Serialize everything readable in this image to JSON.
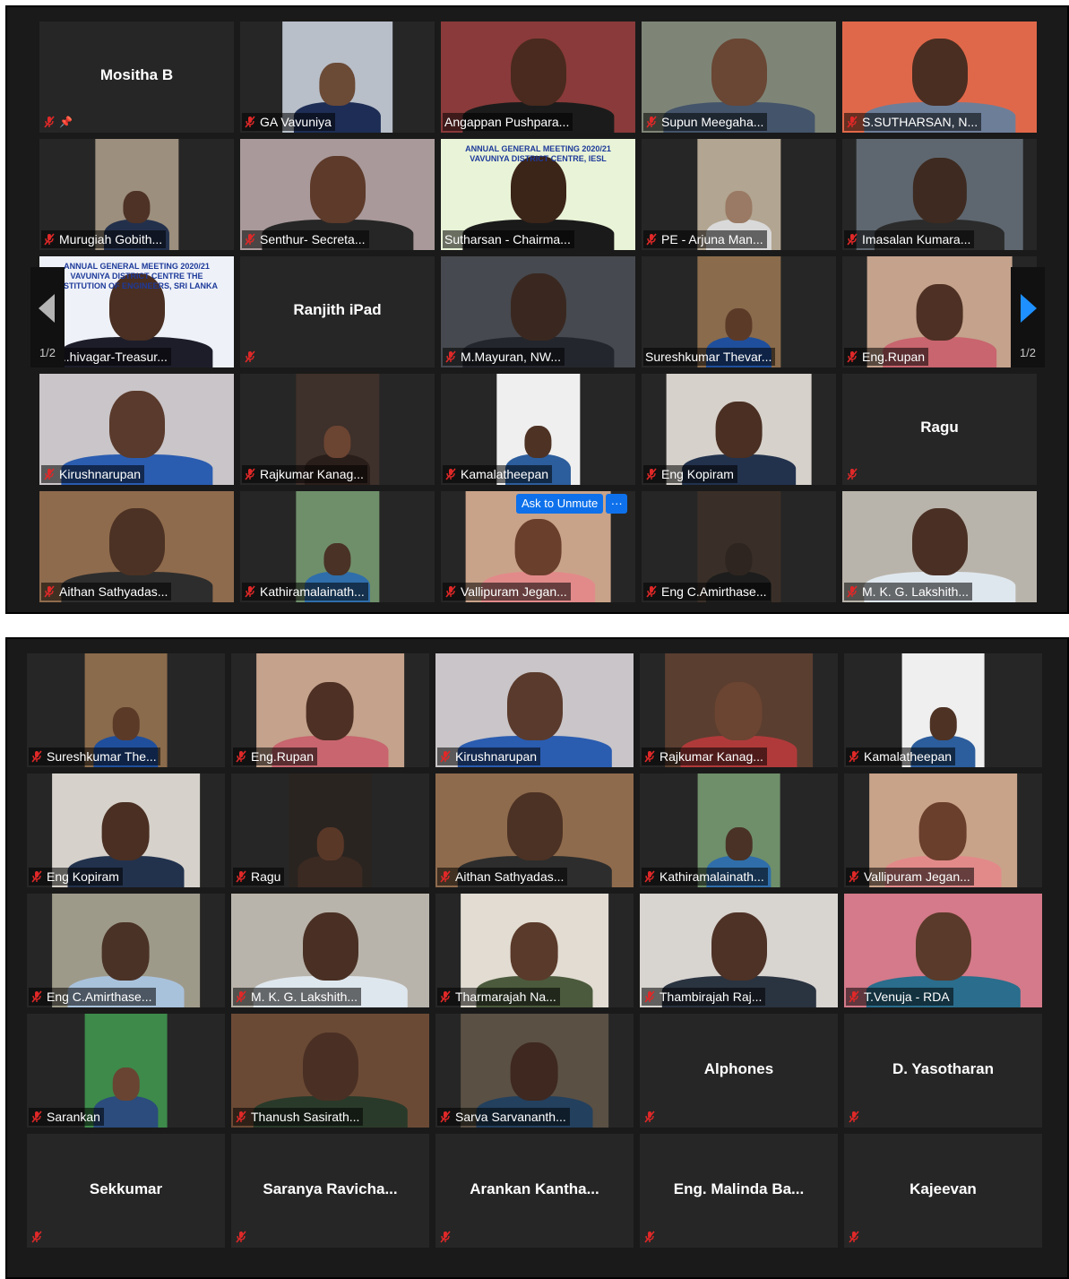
{
  "colors": {
    "tile_bg": "#262626",
    "panel_bg": "#1a1a1a",
    "active_speaker_border": "#f5e52a",
    "muted_icon": "#e02828",
    "zoom_blue": "#0e71eb",
    "nav_arrow_blue": "#1e90ff"
  },
  "gallery_view_1": {
    "page_indicator_left": "1/2",
    "page_indicator_right": "1/2",
    "ask_to_unmute_label": "Ask to Unmute",
    "more_options_label": "···",
    "tiles": [
      {
        "name": "Mositha B",
        "video": false,
        "muted": true,
        "pinned": true,
        "label": ""
      },
      {
        "name": "GA Vavuniya",
        "video": true,
        "muted": true,
        "label": "GA Vavuniya",
        "bg": "#b8bfc9",
        "width": 57,
        "skin": "#6b4a36",
        "shirt": "#1d2d55"
      },
      {
        "name": "Angappan Pushparaj",
        "video": true,
        "muted": false,
        "label": "Angappan Pushpara...",
        "bg": "#8a3a3a",
        "width": 100,
        "skin": "#4a2a1e",
        "shirt": "#1b1b1b"
      },
      {
        "name": "Supun Meegahage",
        "video": true,
        "muted": true,
        "label": "Supun Meegaha...",
        "bg": "#7e8577",
        "width": 100,
        "skin": "#6a4634",
        "shirt": "#44546a"
      },
      {
        "name": "S.SUTHARSAN",
        "video": true,
        "muted": true,
        "label": "S.SUTHARSAN, N...",
        "bg": "#e0684a",
        "width": 100,
        "skin": "#4a2e22",
        "shirt": "#6d7e99"
      },
      {
        "name": "Murugiah Gobith",
        "video": true,
        "muted": true,
        "label": "Murugiah Gobith...",
        "bg": "#9c8f7d",
        "width": 43,
        "skin": "#4e3226",
        "shirt": "#23304c"
      },
      {
        "name": "Senthur- Secretary",
        "video": true,
        "muted": true,
        "label": "Senthur- Secreta...",
        "bg": "#a9999a",
        "width": 100,
        "skin": "#5d3a2a",
        "shirt": "#262626"
      },
      {
        "name": "Sutharsan - Chairman",
        "video": true,
        "muted": false,
        "active": true,
        "label": "Sutharsan - Chairma...",
        "bg": "#e9f3d7",
        "width": 100,
        "skin": "#3b2418",
        "shirt": "#1a1a1a",
        "banner": "ANNUAL GENERAL MEETING 2020/21 VAVUNIYA DISTRICT CENTRE, IESL"
      },
      {
        "name": "PE - Arjuna Manage",
        "video": true,
        "muted": true,
        "label": "PE - Arjuna Man...",
        "bg": "#b2a591",
        "width": 43,
        "skin": "#9a7a64",
        "shirt": "#d9d9d9"
      },
      {
        "name": "Imasalan Kumaran",
        "video": true,
        "muted": true,
        "label": "Imasalan Kumara...",
        "bg": "#5e6770",
        "width": 86,
        "skin": "#3e2a20",
        "shirt": "#2b2b2b"
      },
      {
        "name": "Ahivagar-Treasurer",
        "video": true,
        "muted": true,
        "label": "...hivagar-Treasur...",
        "bg": "#eef1f8",
        "width": 100,
        "skin": "#4a2f22",
        "shirt": "#1d1d2a",
        "banner": "ANNUAL GENERAL MEETING 2020/21 VAVUNIYA DISTRICT CENTRE THE INSTITUTION OF ENGINEERS, SRI LANKA"
      },
      {
        "name": "Ranjith iPad",
        "video": false,
        "muted": true,
        "label": ""
      },
      {
        "name": "M.Mayuran",
        "video": true,
        "muted": true,
        "label": "M.Mayuran, NW...",
        "bg": "#46494f",
        "width": 100,
        "skin": "#3a2820",
        "shirt": "#23262d"
      },
      {
        "name": "Sureshkumar Thevarasa",
        "video": true,
        "muted": false,
        "label": "Sureshkumar Thevar...",
        "bg": "#8a6b4c",
        "width": 43,
        "skin": "#5c3a28",
        "shirt": "#1f4f9c"
      },
      {
        "name": "Eng.Rupan",
        "video": true,
        "muted": true,
        "label": "Eng.Rupan",
        "bg": "#c4a28c",
        "width": 75,
        "skin": "#4e3024",
        "shirt": "#c8656e"
      },
      {
        "name": "Kirushnarupan",
        "video": true,
        "muted": true,
        "label": "Kirushnarupan",
        "bg": "#c9c5c8",
        "width": 100,
        "skin": "#5a3a2c",
        "shirt": "#2a5cb0"
      },
      {
        "name": "Rajkumar Kanagaraj",
        "video": true,
        "muted": true,
        "label": "Rajkumar Kanag...",
        "bg": "#3e302a",
        "width": 43,
        "skin": "#6b4432",
        "shirt": "#2a1e1a"
      },
      {
        "name": "Kamalatheepan",
        "video": true,
        "muted": true,
        "label": "Kamalatheepan",
        "bg": "#efefef",
        "width": 43,
        "skin": "#4e3224",
        "shirt": "#2c5d9c"
      },
      {
        "name": "Eng Kopiram",
        "video": true,
        "muted": true,
        "label": "Eng Kopiram",
        "bg": "#d6d1cb",
        "width": 75,
        "skin": "#4a2f22",
        "shirt": "#22324d"
      },
      {
        "name": "Ragu",
        "video": false,
        "muted": true,
        "label": ""
      },
      {
        "name": "Aithan Sathyadas",
        "video": true,
        "muted": true,
        "label": "Aithan Sathyadas...",
        "bg": "#8f6b4d",
        "width": 100,
        "skin": "#4c3224",
        "shirt": "#2d2d2d"
      },
      {
        "name": "Kathiramalainathan",
        "video": true,
        "muted": true,
        "label": "Kathiramalainath...",
        "bg": "#6f8f6a",
        "width": 43,
        "skin": "#4a3226",
        "shirt": "#2f6eaa"
      },
      {
        "name": "Vallipuram Jegan",
        "video": true,
        "muted": true,
        "label": "Vallipuram Jegan...",
        "bg": "#c9a389",
        "width": 75,
        "skin": "#6a3f2c",
        "shirt": "#e28a8a",
        "ask_unmute": true
      },
      {
        "name": "Eng C.Amirthaseelan",
        "video": true,
        "muted": true,
        "label": "Eng C.Amirthase...",
        "bg": "#3a2f28",
        "width": 43,
        "skin": "#2e2520",
        "shirt": "#1d1d1d"
      },
      {
        "name": "M. K. G. Lakshitha",
        "video": true,
        "muted": true,
        "label": "M. K. G. Lakshith...",
        "bg": "#b9b4ab",
        "width": 100,
        "skin": "#4a3024",
        "shirt": "#dfe7ee"
      }
    ]
  },
  "gallery_view_2": {
    "tiles": [
      {
        "name": "Sureshkumar Thevarasa",
        "video": true,
        "muted": true,
        "label": "Sureshkumar The...",
        "bg": "#8a6b4c",
        "width": 42,
        "skin": "#5c3a28",
        "shirt": "#1f4f9c"
      },
      {
        "name": "Eng.Rupan",
        "video": true,
        "muted": true,
        "label": "Eng.Rupan",
        "bg": "#c4a28c",
        "width": 75,
        "skin": "#4e3024",
        "shirt": "#c8656e"
      },
      {
        "name": "Kirushnarupan",
        "video": true,
        "muted": true,
        "label": "Kirushnarupan",
        "bg": "#c9c5c8",
        "width": 100,
        "skin": "#5a3a2c",
        "shirt": "#2a5cb0"
      },
      {
        "name": "Rajkumar Kanagaraj",
        "video": true,
        "muted": true,
        "label": "Rajkumar Kanag...",
        "bg": "#5a3e30",
        "width": 75,
        "skin": "#6b4432",
        "shirt": "#b03a3a"
      },
      {
        "name": "Kamalatheepan",
        "video": true,
        "muted": true,
        "label": "Kamalatheepan",
        "bg": "#efefef",
        "width": 42,
        "skin": "#4e3224",
        "shirt": "#2c5d9c"
      },
      {
        "name": "Eng Kopiram",
        "video": true,
        "muted": true,
        "label": "Eng Kopiram",
        "bg": "#d6d1cb",
        "width": 75,
        "skin": "#4a2f22",
        "shirt": "#22324d"
      },
      {
        "name": "Ragu",
        "video": true,
        "muted": true,
        "label": "Ragu",
        "bg": "#2a2420",
        "width": 42,
        "skin": "#5a3828",
        "shirt": "#3b2a22"
      },
      {
        "name": "Aithan Sathyadas",
        "video": true,
        "muted": true,
        "label": "Aithan Sathyadas...",
        "bg": "#8f6b4d",
        "width": 100,
        "skin": "#4c3224",
        "shirt": "#2d2d2d"
      },
      {
        "name": "Kathiramalainathan",
        "video": true,
        "muted": true,
        "label": "Kathiramalainath...",
        "bg": "#6f8f6a",
        "width": 42,
        "skin": "#4a3226",
        "shirt": "#2f6eaa"
      },
      {
        "name": "Vallipuram Jegan",
        "video": true,
        "muted": true,
        "label": "Vallipuram Jegan...",
        "bg": "#c9a389",
        "width": 75,
        "skin": "#6a3f2c",
        "shirt": "#e28a8a"
      },
      {
        "name": "Eng C.Amirthaseelan",
        "video": true,
        "muted": true,
        "label": "Eng C.Amirthase...",
        "bg": "#9e9a8a",
        "width": 75,
        "skin": "#4a3226",
        "shirt": "#a9c2dc"
      },
      {
        "name": "M. K. G. Lakshitha",
        "video": true,
        "muted": true,
        "label": "M. K. G. Lakshith...",
        "bg": "#b9b4ab",
        "width": 100,
        "skin": "#4a3024",
        "shirt": "#dfe7ee"
      },
      {
        "name": "Tharmarajah Nadarajah",
        "video": true,
        "muted": true,
        "label": "Tharmarajah Na...",
        "bg": "#e2dcd2",
        "width": 75,
        "skin": "#5a3a2a",
        "shirt": "#4b5a3c"
      },
      {
        "name": "Thambirajah Rajendran",
        "video": true,
        "muted": true,
        "label": "Thambirajah Raj...",
        "bg": "#d8d4d0",
        "width": 100,
        "skin": "#4e3226",
        "shirt": "#2a3340"
      },
      {
        "name": "T.Venuja - RDA",
        "video": true,
        "muted": true,
        "label": "T.Venuja - RDA",
        "bg": "#d47a8a",
        "width": 100,
        "skin": "#5a3a2a",
        "shirt": "#2a6d8c"
      },
      {
        "name": "Sarankan",
        "video": true,
        "muted": true,
        "label": "Sarankan",
        "bg": "#3d8a4a",
        "width": 42,
        "skin": "#6a4432",
        "shirt": "#2b4c7c"
      },
      {
        "name": "Thanush Sasirathan",
        "video": true,
        "muted": true,
        "label": "Thanush Sasirath...",
        "bg": "#6b4a35",
        "width": 100,
        "skin": "#4a3024",
        "shirt": "#2a3a2a"
      },
      {
        "name": "Sarva Sarvananthan",
        "video": true,
        "muted": true,
        "label": "Sarva Sarvananth...",
        "bg": "#5a5044",
        "width": 75,
        "skin": "#3e2820",
        "shirt": "#23405e"
      },
      {
        "name": "Alphones",
        "video": false,
        "muted": true,
        "label": ""
      },
      {
        "name": "D. Yasotharan",
        "video": false,
        "muted": true,
        "label": ""
      },
      {
        "name": "Sekkumar",
        "video": false,
        "muted": true,
        "label": ""
      },
      {
        "name": "Saranya  Ravicha...",
        "video": false,
        "muted": true,
        "label": ""
      },
      {
        "name": "Arankan  Kantha...",
        "video": false,
        "muted": true,
        "label": ""
      },
      {
        "name": "Eng.  Malinda  Ba...",
        "video": false,
        "muted": true,
        "label": ""
      },
      {
        "name": "Kajeevan",
        "video": false,
        "muted": true,
        "label": ""
      }
    ]
  }
}
